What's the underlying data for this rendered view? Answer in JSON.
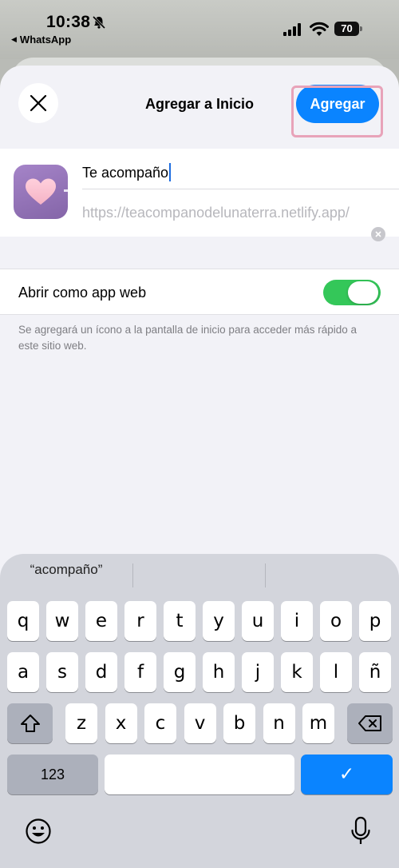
{
  "status": {
    "time": "10:38",
    "back_app": "WhatsApp",
    "battery": "70"
  },
  "sheet": {
    "title": "Agregar a Inicio",
    "add_label": "Agregar",
    "name_value": "Te acompaño",
    "url": "https://teacompanodelunaterra.netlify.app/",
    "toggle_label": "Abrir como app web",
    "toggle_on": true,
    "footnote": "Se agregará un ícono a la pantalla de inicio para acceder más rápido a este sitio web."
  },
  "keyboard": {
    "suggestion": "“acompaño”",
    "row1": [
      "q",
      "w",
      "e",
      "r",
      "t",
      "y",
      "u",
      "i",
      "o",
      "p"
    ],
    "row2": [
      "a",
      "s",
      "d",
      "f",
      "g",
      "h",
      "j",
      "k",
      "l",
      "ñ"
    ],
    "row3": [
      "z",
      "x",
      "c",
      "v",
      "b",
      "n",
      "m"
    ],
    "numbers_label": "123",
    "done_glyph": "✓"
  },
  "colors": {
    "accent": "#0a84ff",
    "toggle_on": "#34c759",
    "highlight": "#e8a3b9"
  }
}
